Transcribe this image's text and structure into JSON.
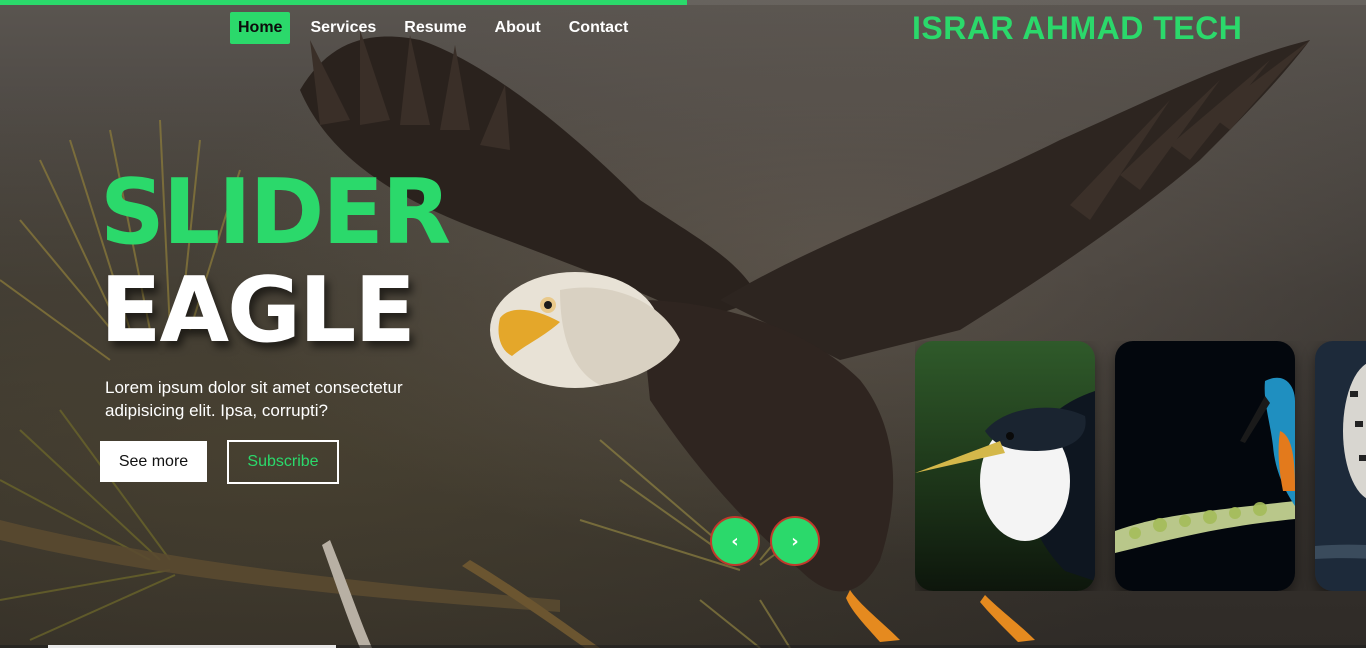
{
  "header": {
    "brand": "ISRAR AHMAD TECH",
    "progress_fraction": 0.503
  },
  "nav": {
    "items": [
      {
        "label": "Home",
        "active": true
      },
      {
        "label": "Services",
        "active": false
      },
      {
        "label": "Resume",
        "active": false
      },
      {
        "label": "About",
        "active": false
      },
      {
        "label": "Contact",
        "active": false
      }
    ]
  },
  "hero": {
    "title_line1": "SLIDER",
    "title_line2": "EAGLE",
    "description": "Lorem ipsum dolor sit amet consectetur adipisicing elit. Ipsa, corrupti?",
    "buttons": {
      "see_more": "See more",
      "subscribe": "Subscribe"
    }
  },
  "slider": {
    "prev_icon": "chevron-left-icon",
    "next_icon": "chevron-right-icon",
    "prev_glyph": "‹",
    "next_glyph": "›"
  },
  "thumbnails": [
    {
      "subject": "pied kingfisher"
    },
    {
      "subject": "common kingfisher"
    },
    {
      "subject": "woodpecker"
    }
  ],
  "colors": {
    "accent": "#2bd96b",
    "text": "#ffffff",
    "arrow_border": "#c0392b"
  }
}
